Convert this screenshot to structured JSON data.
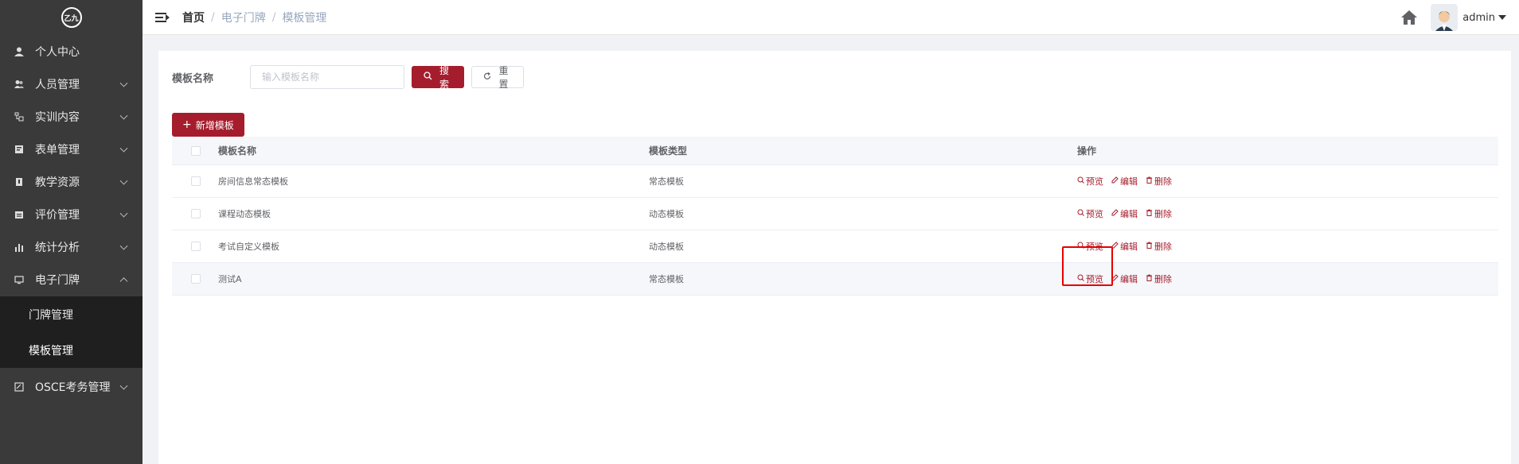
{
  "logo": {
    "text": "乙九"
  },
  "sidebar": {
    "items": [
      {
        "label": "个人中心",
        "icon": "user-icon",
        "has_chevron": false
      },
      {
        "label": "人员管理",
        "icon": "users-icon",
        "has_chevron": true
      },
      {
        "label": "实训内容",
        "icon": "training-icon",
        "has_chevron": true
      },
      {
        "label": "表单管理",
        "icon": "form-icon",
        "has_chevron": true
      },
      {
        "label": "教学资源",
        "icon": "book-icon",
        "has_chevron": true
      },
      {
        "label": "评价管理",
        "icon": "evaluation-icon",
        "has_chevron": true
      },
      {
        "label": "统计分析",
        "icon": "bar-chart-icon",
        "has_chevron": true
      },
      {
        "label": "电子门牌",
        "icon": "monitor-icon",
        "has_chevron": true,
        "expanded": true
      }
    ],
    "submenu": [
      {
        "label": "门牌管理",
        "active": false
      },
      {
        "label": "模板管理",
        "active": true
      }
    ],
    "after": {
      "label": "OSCE考务管理",
      "icon": "exam-icon"
    }
  },
  "breadcrumb": {
    "home": "首页",
    "level1": "电子门牌",
    "level2": "模板管理"
  },
  "user": {
    "name": "admin"
  },
  "search": {
    "label": "模板名称",
    "placeholder": "输入模板名称",
    "value": "",
    "search_btn": "搜索",
    "reset_btn": "重置"
  },
  "add_btn": "新增模板",
  "table": {
    "headers": {
      "name": "模板名称",
      "type": "模板类型",
      "ops": "操作"
    },
    "rows": [
      {
        "name": "房间信息常态模板",
        "type": "常态模板"
      },
      {
        "name": "课程动态模板",
        "type": "动态模板"
      },
      {
        "name": "考试自定义模板",
        "type": "动态模板"
      },
      {
        "name": "测试A",
        "type": "常态模板"
      }
    ],
    "ops": {
      "preview": "预览",
      "edit": "编辑",
      "delete": "删除"
    }
  },
  "colors": {
    "primary": "#a51d2d",
    "sidebar": "#3a3a3a",
    "submenu": "#1f1f1f",
    "highlight": "#e60000"
  }
}
